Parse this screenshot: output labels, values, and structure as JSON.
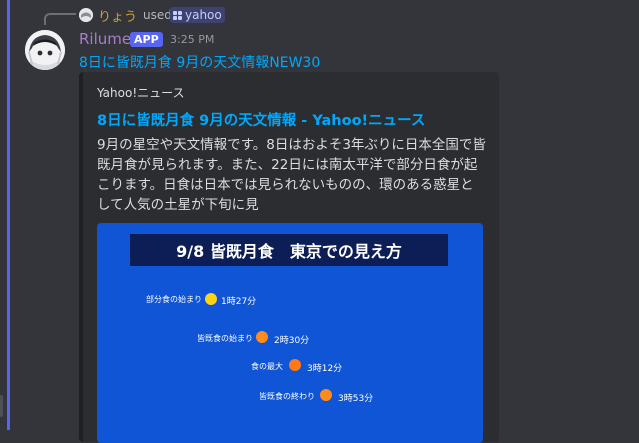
{
  "reply": {
    "user": "りょう",
    "used_text": "used",
    "command": "yahoo"
  },
  "author": {
    "name": "Rilume",
    "badge": "APP",
    "time": "3:25 PM"
  },
  "message": {
    "link_text": "8日に皆既月食 9月の天文情報NEW30"
  },
  "embed": {
    "provider": "Yahoo!ニュース",
    "title": "8日に皆既月食 9月の天文情報 - Yahoo!ニュース",
    "description": "9月の星空や天文情報です。8日はおよそ3年ぶりに日本全国で皆既月食が見られます。また、22日には南太平洋で部分日食が起こります。日食は日本では見られないものの、環のある惑星として人気の土星が下旬に見",
    "image": {
      "title": "9/8 皆既月食　東京での見え方",
      "phases": [
        {
          "label": "部分食の始まり",
          "time": "1時27分",
          "dot_color": "#ffd21a"
        },
        {
          "label": "皆既食の始まり",
          "time": "2時30分",
          "dot_color": "#ff8c1a"
        },
        {
          "label": "食の最大",
          "time": "3時12分",
          "dot_color": "#ff7a14"
        },
        {
          "label": "皆既食の終わり",
          "time": "3時53分",
          "dot_color": "#ff8c1a"
        }
      ]
    }
  },
  "colors": {
    "accent": "#5865f2",
    "link": "#00a8fc",
    "username": "#a87ec8"
  }
}
